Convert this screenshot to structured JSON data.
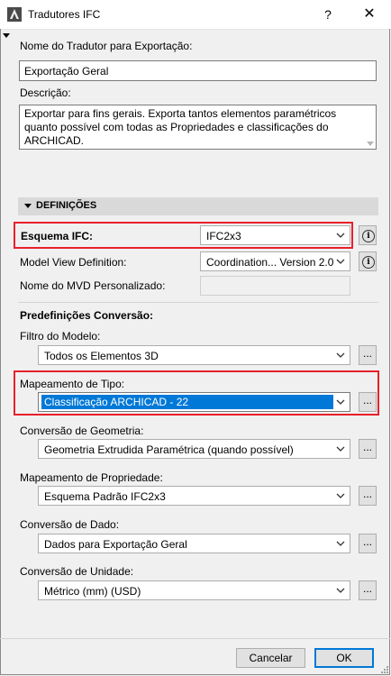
{
  "window": {
    "title": "Tradutores IFC",
    "help_glyph": "?",
    "close_glyph": "✕"
  },
  "translator": {
    "name_label": "Nome do Tradutor para Exportação:",
    "name_value": "Exportação Geral",
    "description_label": "Descrição:",
    "description_value": "Exportar para fins gerais. Exporta tantos elementos paramétricos quanto possível com todas as Propriedades e classificações do ARCHICAD."
  },
  "definitions": {
    "section_title": "DEFINIÇÕES",
    "schema_label": "Esquema IFC:",
    "schema_value": "IFC2x3",
    "mvd_label": "Model View Definition:",
    "mvd_value": "Coordination... Version 2.0",
    "custom_mvd_label": "Nome do MVD Personalizado:",
    "custom_mvd_value": "",
    "presets_heading": "Predefinições Conversão:",
    "model_filter_label": "Filtro do Modelo:",
    "model_filter_value": "Todos os Elementos 3D",
    "type_mapping_label": "Mapeamento de Tipo:",
    "type_mapping_value": "Classificação ARCHICAD - 22",
    "geometry_label": "Conversão de Geometria:",
    "geometry_value": "Geometria Extrudida Paramétrica (quando possível)",
    "property_mapping_label": "Mapeamento de Propriedade:",
    "property_mapping_value": "Esquema Padrão IFC2x3",
    "data_conversion_label": "Conversão de Dado:",
    "data_conversion_value": "Dados para Exportação Geral",
    "unit_conversion_label": "Conversão de Unidade:",
    "unit_conversion_value": "Métrico (mm) (USD)",
    "ellipsis": "...",
    "info_glyph": "i"
  },
  "footer": {
    "cancel_label": "Cancelar",
    "ok_label": "OK"
  },
  "colors": {
    "highlight_box": "#e8202b",
    "selection": "#0078d7"
  }
}
